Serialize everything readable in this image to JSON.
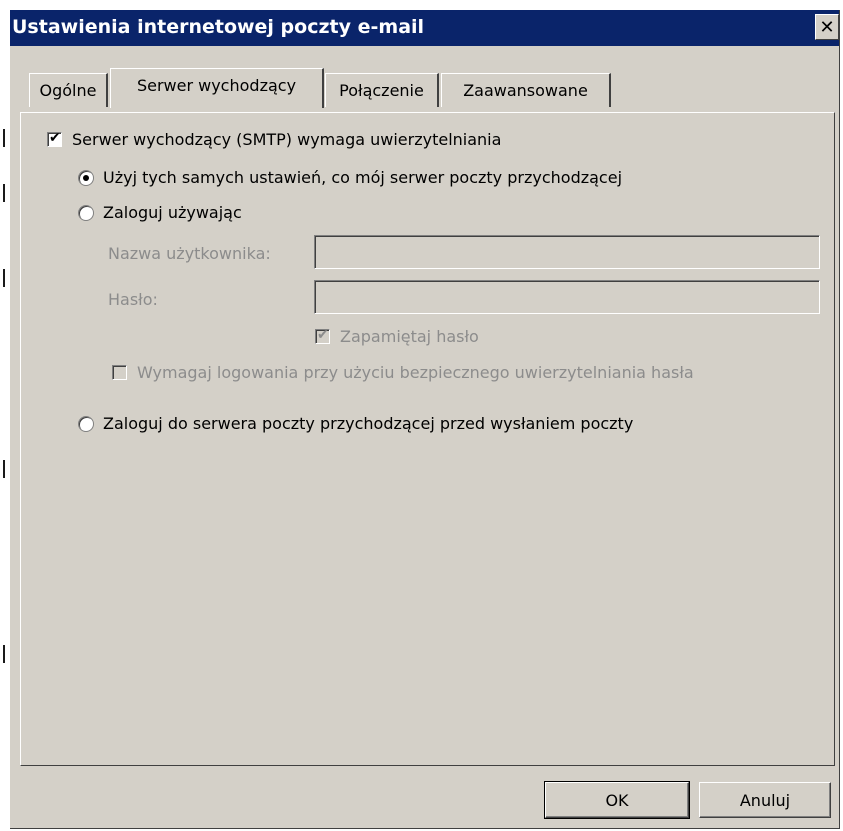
{
  "window": {
    "title": "Ustawienia internetowej poczty e-mail",
    "close_icon": "close-icon"
  },
  "tabs": [
    {
      "label": "Ogólne",
      "active": false
    },
    {
      "label": "Serwer wychodzący",
      "active": true
    },
    {
      "label": "Połączenie",
      "active": false
    },
    {
      "label": "Zaawansowane",
      "active": false
    }
  ],
  "smtp": {
    "requires_auth_label": "Serwer wychodzący (SMTP) wymaga uwierzytelniania",
    "requires_auth_checked": true,
    "option_same_label": "Użyj tych samych ustawień, co mój serwer poczty przychodzącej",
    "option_same_selected": true,
    "option_login_label": "Zaloguj używając",
    "option_login_selected": false,
    "username_label": "Nazwa użytkownika:",
    "username_value": "",
    "password_label": "Hasło:",
    "password_value": "",
    "remember_password_label": "Zapamiętaj hasło",
    "remember_password_checked": true,
    "spa_label": "Wymagaj logowania przy użyciu bezpiecznego uwierzytelniania hasła",
    "spa_checked": false,
    "option_pop_first_label": "Zaloguj do serwera poczty przychodzącej przed wysłaniem poczty",
    "option_pop_first_selected": false
  },
  "buttons": {
    "ok_label": "OK",
    "cancel_label": "Anuluj"
  },
  "colors": {
    "titlebar": "#0a246a",
    "dialog_face": "#d4d0c8",
    "disabled_text": "#8c8c8c"
  }
}
